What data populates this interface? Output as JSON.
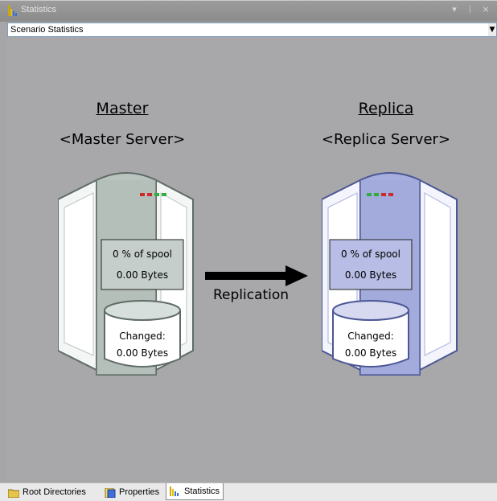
{
  "window": {
    "title": "Statistics",
    "controls": [
      "▾",
      "ᚿ",
      "×"
    ]
  },
  "scenario_select": {
    "value": "Scenario Statistics"
  },
  "master": {
    "heading": "Master",
    "name": "<Master Server>",
    "spool_percent": "0 % of spool",
    "spool_bytes": "0.00 Bytes",
    "changed_label": "Changed:",
    "changed_bytes": "0.00 Bytes",
    "body_color": "#b9c4bf",
    "leds": [
      "#cc2b2b",
      "#cc2b2b",
      "#2fae3d",
      "#2fae3d"
    ]
  },
  "replica": {
    "heading": "Replica",
    "name": "<Replica Server>",
    "spool_percent": "0 % of spool",
    "spool_bytes": "0.00 Bytes",
    "changed_label": "Changed:",
    "changed_bytes": "0.00 Bytes",
    "body_color": "#a6aede",
    "leds": [
      "#2fae3d",
      "#2fae3d",
      "#cc2b2b",
      "#cc2b2b"
    ]
  },
  "replication_label": "Replication",
  "tabs": [
    {
      "label": "Root Directories",
      "icon": "folder-icon",
      "active": false
    },
    {
      "label": "Properties",
      "icon": "properties-icon",
      "active": false
    },
    {
      "label": "Statistics",
      "icon": "statistics-icon",
      "active": true
    }
  ]
}
